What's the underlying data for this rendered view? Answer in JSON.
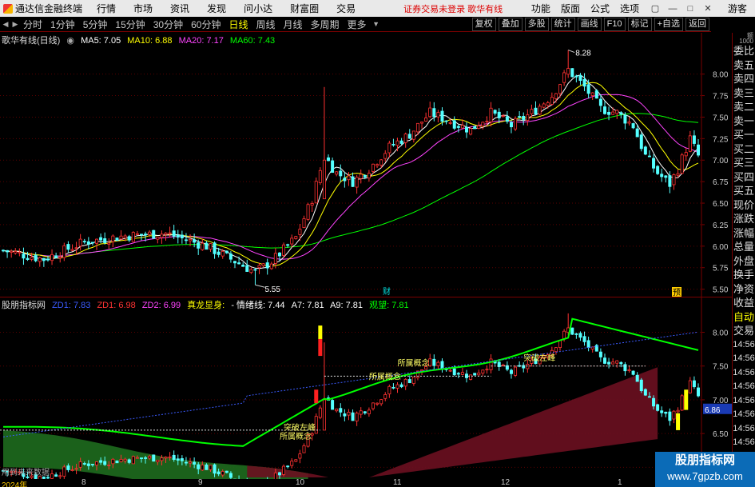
{
  "app": {
    "name": "通达信金融终端",
    "menus": [
      "行情",
      "市场",
      "资讯",
      "发现",
      "问小达",
      "财富圈",
      "交易"
    ],
    "notice": "证券交易未登录  歌华有线",
    "right_menus": [
      "功能",
      "版面",
      "公式",
      "选项"
    ],
    "guest": "游客"
  },
  "toolbar": {
    "periods": [
      "分时",
      "1分钟",
      "5分钟",
      "15分钟",
      "30分钟",
      "60分钟",
      "日线",
      "周线",
      "月线",
      "多周期",
      "更多"
    ],
    "active_period": "日线",
    "buttons": [
      "复权",
      "叠加",
      "多股",
      "统计",
      "画线",
      "F10",
      "标记",
      "+自选",
      "返回"
    ]
  },
  "kline": {
    "title": "歌华有线(日线)",
    "ma": [
      {
        "label": "MA5: 7.05",
        "color": "#ffffff"
      },
      {
        "label": "MA10: 6.88",
        "color": "#ffff00"
      },
      {
        "label": "MA20: 7.17",
        "color": "#ff00ff"
      },
      {
        "label": "MA60: 7.43",
        "color": "#00ff00"
      }
    ],
    "y_ticks": [
      "8.00",
      "7.75",
      "7.50",
      "7.25",
      "7.00",
      "6.75",
      "6.50",
      "6.25",
      "6.00",
      "5.75",
      "5.50"
    ],
    "y_range": [
      5.45,
      8.35
    ],
    "high_label": "8.28",
    "low_label": "5.55",
    "marker_cai": "财",
    "marker_yu": "预"
  },
  "indicator": {
    "name": "股朋指标网",
    "values": [
      {
        "label": "ZD1: 7.83",
        "color": "#3b5bff"
      },
      {
        "label": "ZD1: 6.98",
        "color": "#ff3333"
      },
      {
        "label": "ZD2: 6.99",
        "color": "#ff44ff"
      },
      {
        "label": "真龙显身:",
        "color": "#ffff00"
      },
      {
        "label": "- 情绪线: 7.44",
        "color": "#ffffff"
      },
      {
        "label": "A7: 7.81",
        "color": "#ffffff"
      },
      {
        "label": "A9: 7.81",
        "color": "#ffffff"
      },
      {
        "label": "观望: 7.81",
        "color": "#00ff00"
      }
    ],
    "y_ticks": [
      "8.00",
      "7.50",
      "7.00",
      "6.50",
      "6.00"
    ],
    "y_range": [
      5.85,
      8.35
    ],
    "current_value": "6.86",
    "annotations": [
      "所属概念",
      "所属概念",
      "所属概念",
      "突破左峰",
      "突破左峰"
    ],
    "footer_text": "用到未来数据"
  },
  "right_tabs": [
    "委比",
    "卖五",
    "卖四",
    "卖三",
    "卖二",
    "卖一",
    "买一",
    "买二",
    "买三",
    "买四",
    "买五",
    "现价",
    "涨跌",
    "涨幅",
    "总量",
    "外盘",
    "换手",
    "净资",
    "收益",
    "自动",
    "交易",
    "14:56",
    "14:56",
    "14:56",
    "14:56",
    "14:56",
    "14:56",
    "14:56",
    "14:56",
    "14:56"
  ],
  "right_tab_corner": "额 1000",
  "dates": [
    "2024年",
    "8",
    "9",
    "10",
    "11",
    "12",
    "1"
  ],
  "watermark": {
    "title": "股朋指标网",
    "url": "www.7gpzb.com"
  },
  "colors": {
    "up": "#ff3232",
    "down": "#54ffff",
    "frame": "#7a0000"
  },
  "chart_data": {
    "type": "candlestick",
    "title": "歌华有线(日线)",
    "y_range": [
      5.45,
      8.35
    ],
    "high": 8.28,
    "low": 5.55,
    "ma": {
      "MA5": 7.05,
      "MA10": 6.88,
      "MA20": 7.17,
      "MA60": 7.43
    },
    "waypoints": [
      [
        0,
        5.95
      ],
      [
        10,
        5.85
      ],
      [
        20,
        6.05
      ],
      [
        30,
        6.12
      ],
      [
        40,
        6.15
      ],
      [
        50,
        6.0
      ],
      [
        58,
        5.8
      ],
      [
        62,
        5.7
      ],
      [
        66,
        5.82
      ],
      [
        72,
        6.1
      ],
      [
        76,
        6.55
      ],
      [
        79,
        7.05
      ],
      [
        82,
        6.85
      ],
      [
        86,
        6.75
      ],
      [
        90,
        6.9
      ],
      [
        95,
        7.15
      ],
      [
        100,
        7.3
      ],
      [
        105,
        7.55
      ],
      [
        110,
        7.45
      ],
      [
        115,
        7.35
      ],
      [
        120,
        7.55
      ],
      [
        125,
        7.4
      ],
      [
        130,
        7.55
      ],
      [
        135,
        7.75
      ],
      [
        139,
        8.05
      ],
      [
        143,
        7.85
      ],
      [
        147,
        7.6
      ],
      [
        151,
        7.55
      ],
      [
        155,
        7.4
      ],
      [
        158,
        7.05
      ],
      [
        161,
        6.85
      ],
      [
        164,
        6.72
      ],
      [
        166,
        6.9
      ],
      [
        169,
        7.25
      ],
      [
        171,
        7.05
      ]
    ]
  }
}
